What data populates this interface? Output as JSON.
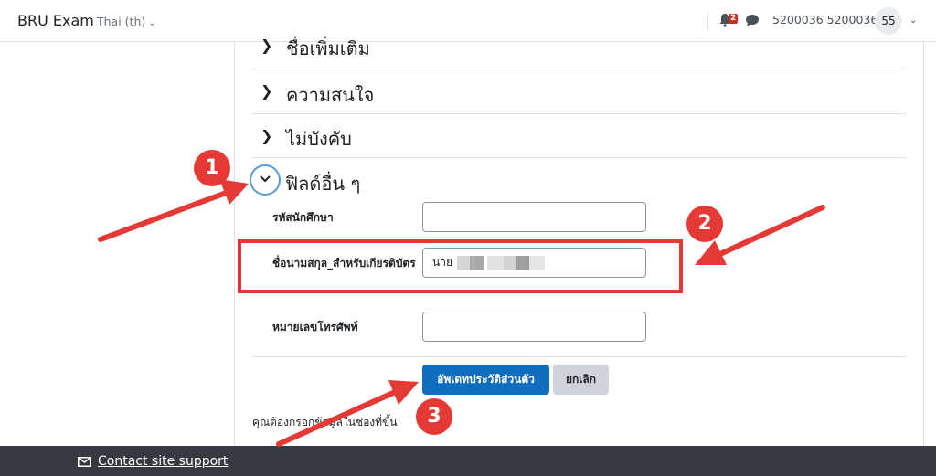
{
  "navbar": {
    "brand": "BRU Exam",
    "language": "Thai (th)",
    "notification_count": "2",
    "username": "5200036 5200036",
    "avatar_initials": "55"
  },
  "sections": [
    {
      "title": "ชื่อเพิ่มเติม"
    },
    {
      "title": "ความสนใจ"
    },
    {
      "title": "ไม่บังคับ"
    },
    {
      "title": "ฟิลด์อื่น ๆ"
    }
  ],
  "form": {
    "student_id_label": "รหัสนักศึกษา",
    "student_id_value": "",
    "cert_name_label": "ชื่อนามสกุล_สำหรับเกียรติบัตร",
    "cert_name_value": "นาย",
    "phone_label": "หมายเลขโทรศัพท์",
    "phone_value": "",
    "update_button": "อัพเดทประวัติส่วนตัว",
    "cancel_button": "ยกเลิก",
    "required_note": "คุณต้องกรอกข้อมูลในช่องที่ขึ้น"
  },
  "footer": {
    "support_link": "Contact site support"
  },
  "annotations": {
    "step1": "1",
    "step2": "2",
    "step3": "3",
    "color": "#e53935"
  },
  "colors": {
    "primary": "#0f6cbf",
    "footer_bg": "#343a40",
    "badge": "#ca3120"
  }
}
